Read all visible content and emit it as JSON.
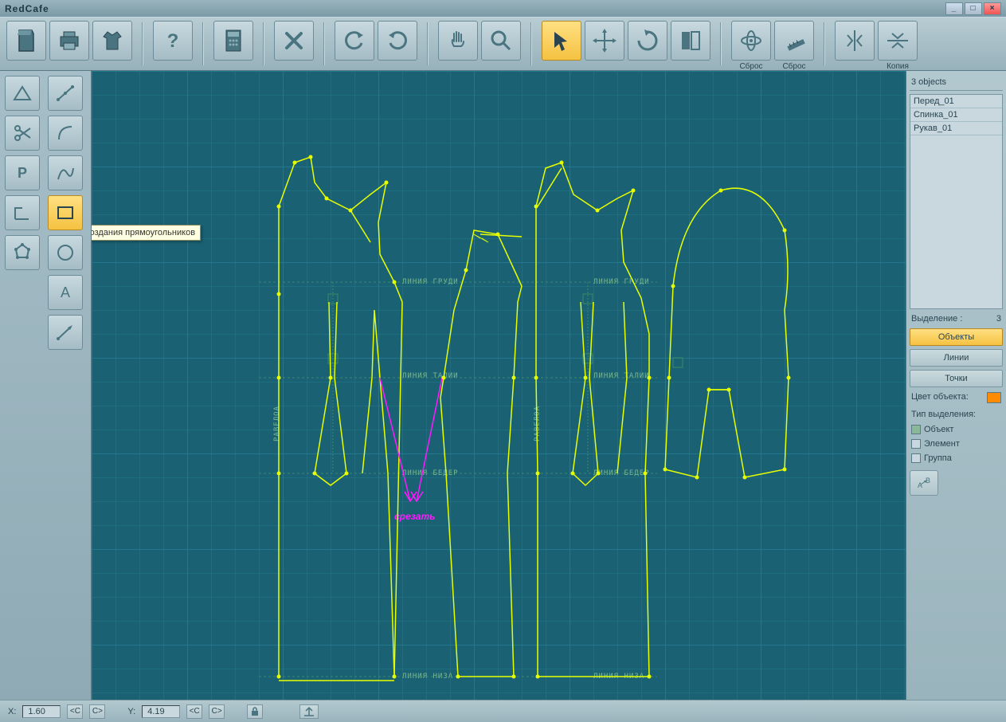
{
  "app": {
    "title": "RedCafe"
  },
  "toolbar": {
    "reset1": "Сброс",
    "reset2": "Сброс",
    "copy": "Копия"
  },
  "tooltip": "Режим создания прямоугольников",
  "right": {
    "objects_header": "3 objects",
    "items": [
      "Перед_01",
      "Спинка_01",
      "Рукав_01"
    ],
    "selection_label": "Выделение :",
    "selection_count": "3",
    "btn_objects": "Объекты",
    "btn_lines": "Линии",
    "btn_points": "Точки",
    "color_label": "Цвет объекта:",
    "type_label": "Тип выделения:",
    "chk_object": "Объект",
    "chk_element": "Элемент",
    "chk_group": "Группа",
    "rename_btn": "A↔B"
  },
  "status": {
    "x_label": "X:",
    "x_value": "1.60",
    "y_label": "Y:",
    "y_value": "4.19",
    "lt": "<C",
    "gt": "C>"
  },
  "canvas": {
    "labels": {
      "chest1": "ЛИНИЯ ГРУДИ",
      "chest2": "ЛИНИЯ ГРУДИ",
      "waist1": "ЛИНИЯ ТАЛИИ",
      "waist2": "ЛИНИЯ ТАЛИИ",
      "hip1": "ЛИНИЯ БЕДЕР",
      "hip2": "ЛИНИЯ БЕДЕР",
      "hem1": "ЛИНИЯ НИЗА",
      "hem2": "ЛИНИЯ НИЗА",
      "balance1": "РАВЕЛОА",
      "balance2": "РАВЕЛОА"
    },
    "annotation": "срезать"
  }
}
